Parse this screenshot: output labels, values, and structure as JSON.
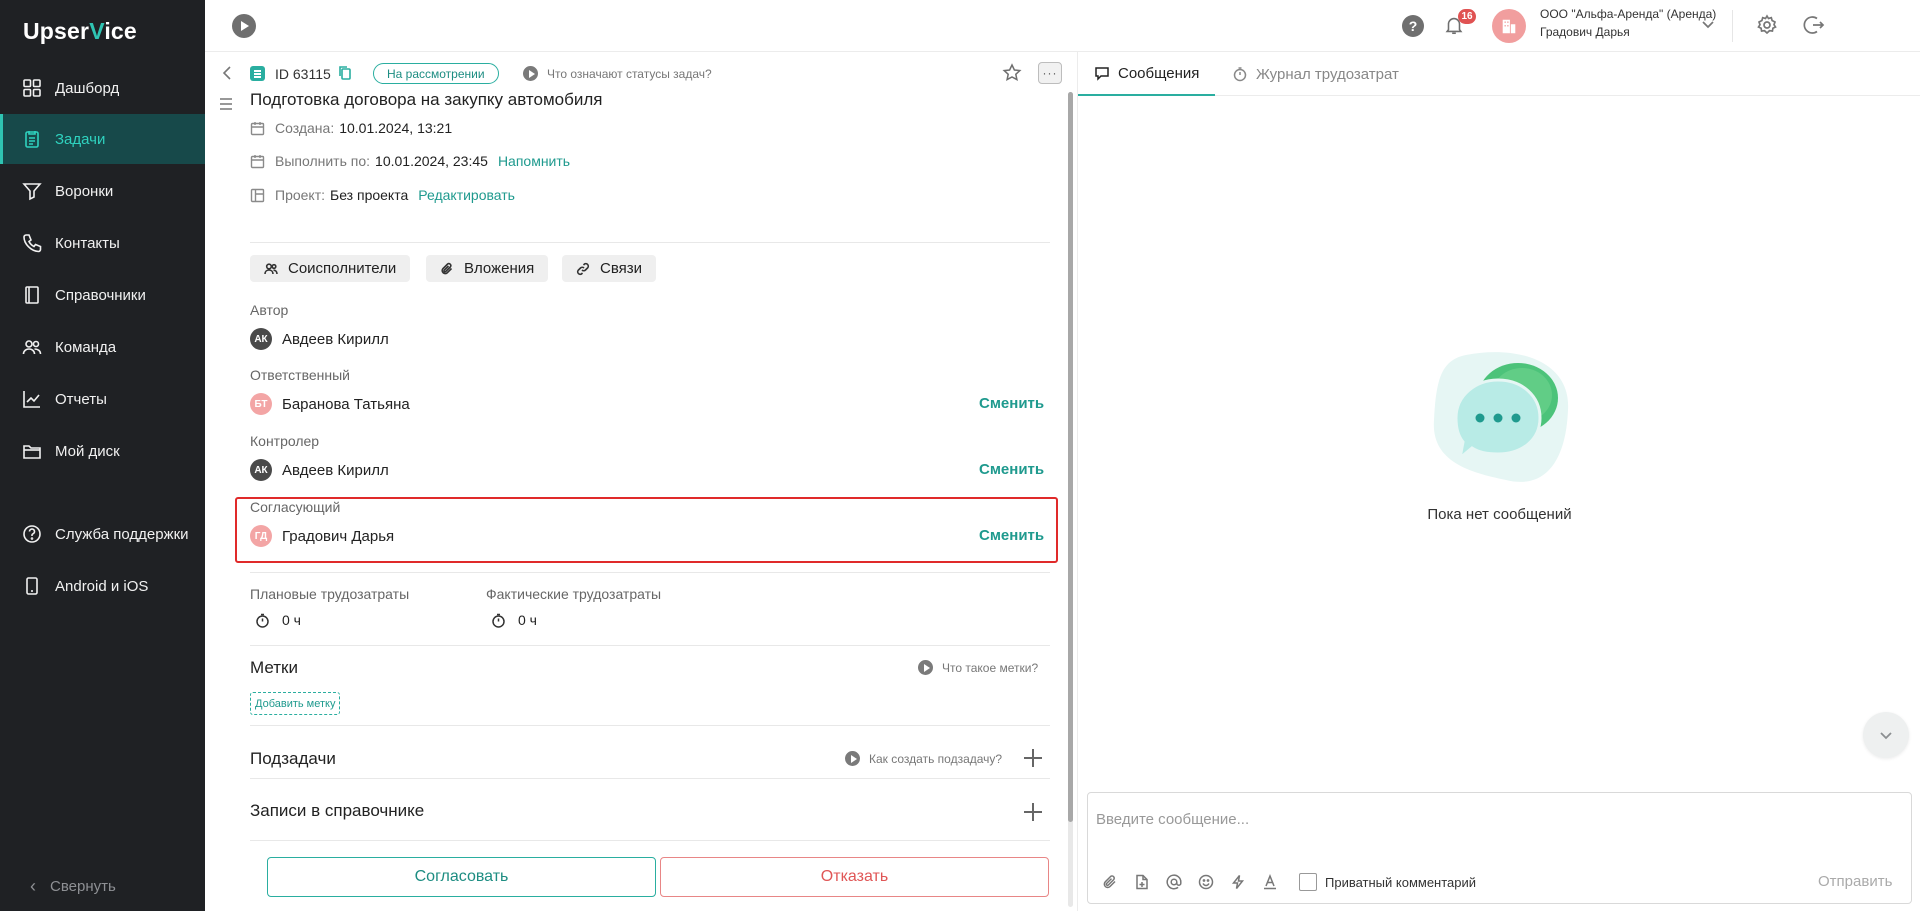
{
  "app": {
    "logo_prefix": "Upser",
    "logo_v": "V",
    "logo_suffix": "ice"
  },
  "sidebar": {
    "items": [
      {
        "label": "Дашборд",
        "icon": "dashboard-icon"
      },
      {
        "label": "Задачи",
        "icon": "tasks-icon",
        "active": true
      },
      {
        "label": "Воронки",
        "icon": "funnel-icon"
      },
      {
        "label": "Контакты",
        "icon": "phone-icon"
      },
      {
        "label": "Справочники",
        "icon": "book-icon"
      },
      {
        "label": "Команда",
        "icon": "team-icon"
      },
      {
        "label": "Отчеты",
        "icon": "chart-icon"
      },
      {
        "label": "Мой диск",
        "icon": "folder-icon"
      },
      {
        "label": "Служба поддержки",
        "icon": "help-circle-icon"
      },
      {
        "label": "Android и iOS",
        "icon": "mobile-icon"
      }
    ],
    "collapse_label": "Свернуть"
  },
  "topbar": {
    "notifications_count": "16",
    "company": "ООО \"Альфа-Аренда\" (Аренда)",
    "user": "Градович Дарья",
    "help_glyph": "?"
  },
  "task": {
    "id": "ID 63115",
    "status": "На рассмотрении",
    "status_help": "Что означают статусы задач?",
    "more_glyph": "···",
    "title": "Подготовка договора на закупку автомобиля",
    "created_label": "Создана:",
    "created_value": "10.01.2024, 13:21",
    "due_label": "Выполнить по:",
    "due_value": "10.01.2024, 23:45",
    "remind_link": "Напомнить",
    "project_label": "Проект:",
    "project_value": "Без проекта",
    "project_edit": "Редактировать",
    "chips": {
      "coexecutors": "Соисполнители",
      "attachments": "Вложения",
      "links": "Связи"
    },
    "author_label": "Автор",
    "author_initials": "АК",
    "author_name": "Авдеев Кирилл",
    "responsible_label": "Ответственный",
    "responsible_initials": "БТ",
    "responsible_name": "Баранова Татьяна",
    "controller_label": "Контролер",
    "controller_initials": "АК",
    "controller_name": "Авдеев Кирилл",
    "approver_label": "Согласующий",
    "approver_initials": "ГД",
    "approver_name": "Градович Дарья",
    "change_label": "Сменить",
    "planned_label": "Плановые трудозатраты",
    "planned_value": "0 ч",
    "actual_label": "Фактические трудозатраты",
    "actual_value": "0 ч",
    "tags_title": "Метки",
    "tags_help": "Что такое метки?",
    "add_tag": "Добавить метку",
    "subtasks_title": "Подзадачи",
    "subtasks_help": "Как создать подзадачу?",
    "records_title": "Записи в справочнике",
    "approve_button": "Согласовать",
    "decline_button": "Отказать"
  },
  "messages": {
    "tab_messages": "Сообщения",
    "tab_timelog": "Журнал трудозатрат",
    "empty_text": "Пока нет сообщений",
    "input_placeholder": "Введите сообщение...",
    "private_label": "Приватный комментарий",
    "send_label": "Отправить"
  },
  "colors": {
    "accent": "#2aaea0",
    "sidebar_bg": "#1f2124",
    "highlight_border": "#e02a2a",
    "danger": "#e05656"
  }
}
